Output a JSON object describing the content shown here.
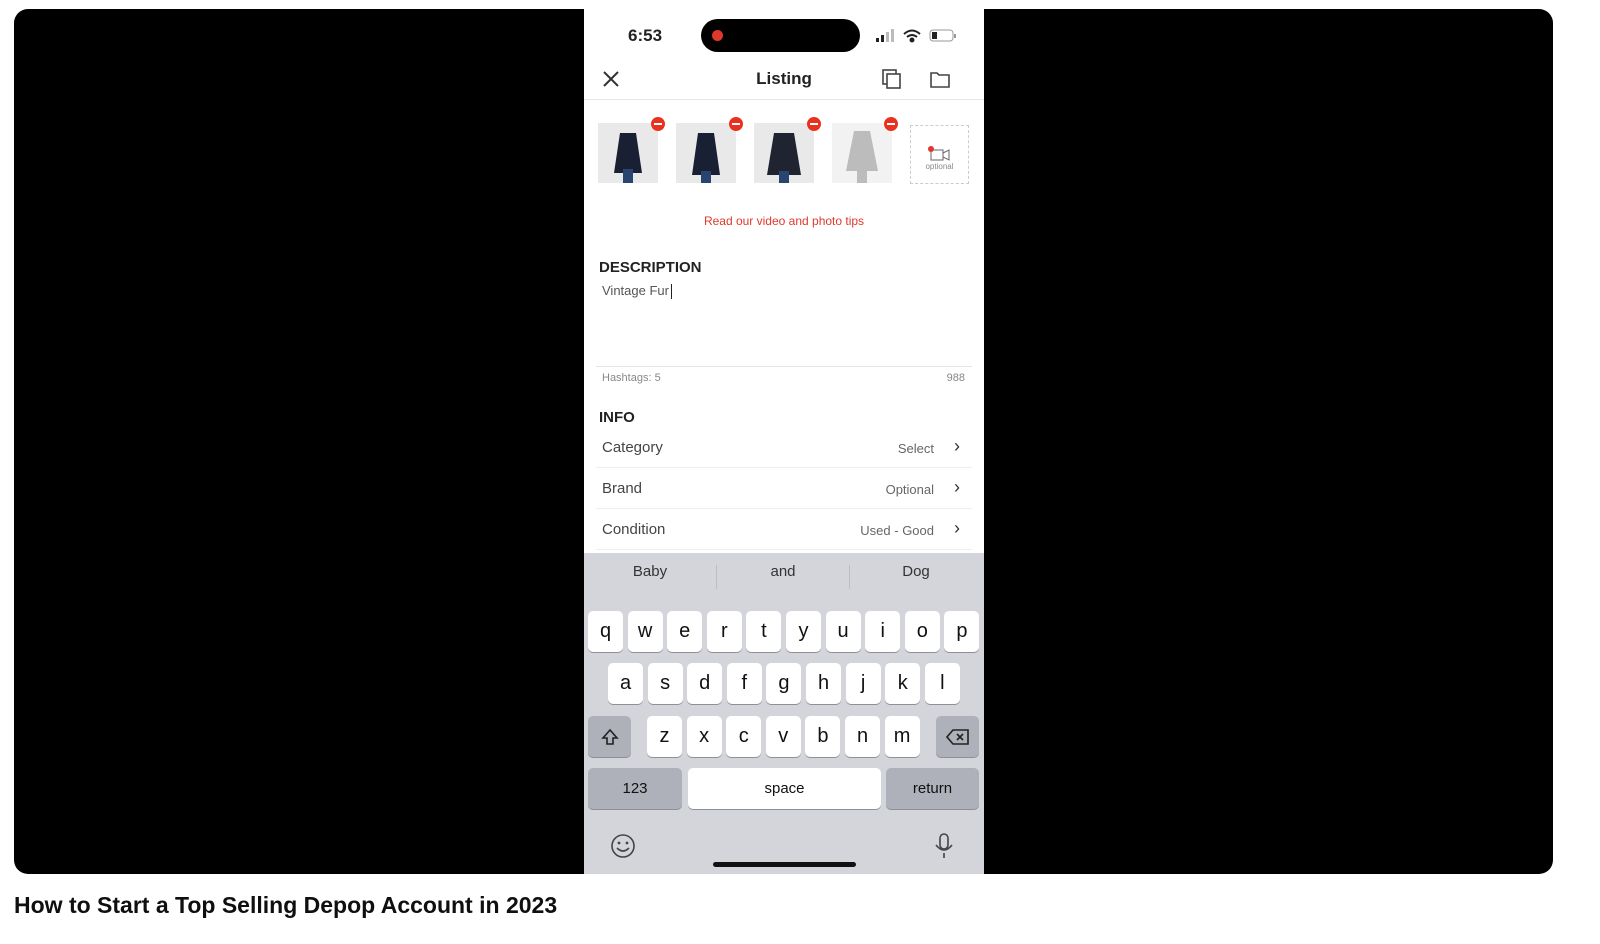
{
  "status_bar": {
    "time": "6:53"
  },
  "header": {
    "title": "Listing",
    "close_icon": "close-icon",
    "copy_icon": "copy-icon",
    "folder_icon": "folder-icon"
  },
  "photos": {
    "count": 4,
    "video_slot_label": "optional",
    "tips_link": "Read our video and photo tips"
  },
  "description": {
    "heading": "DESCRIPTION",
    "value": "Vintage Fur",
    "hashtags": "Hashtags: 5",
    "chars_left": "988"
  },
  "info": {
    "heading": "INFO",
    "rows": [
      {
        "label": "Category",
        "value": "Select"
      },
      {
        "label": "Brand",
        "value": "Optional"
      },
      {
        "label": "Condition",
        "value": "Used - Good"
      }
    ]
  },
  "keyboard": {
    "suggestions": [
      "Baby",
      "and",
      "Dog"
    ],
    "row1": [
      "q",
      "w",
      "e",
      "r",
      "t",
      "y",
      "u",
      "i",
      "o",
      "p"
    ],
    "row2": [
      "a",
      "s",
      "d",
      "f",
      "g",
      "h",
      "j",
      "k",
      "l"
    ],
    "row3": [
      "z",
      "x",
      "c",
      "v",
      "b",
      "n",
      "m"
    ],
    "numbers": "123",
    "space": "space",
    "return": "return"
  },
  "video_title": "How to Start a Top Selling Depop Account in 2023",
  "colors": {
    "accent": "#e0382b",
    "keyboard_bg": "#d3d5db"
  }
}
